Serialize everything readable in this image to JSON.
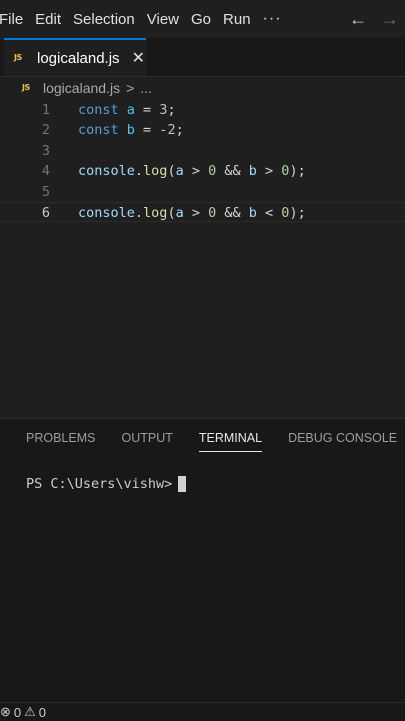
{
  "menubar": {
    "items": [
      "File",
      "Edit",
      "Selection",
      "View",
      "Go",
      "Run"
    ],
    "more": "···",
    "back_icon": "←",
    "forward_icon": "→"
  },
  "tab": {
    "icon_label": "JS",
    "title": "logicaland.js",
    "close": "✕"
  },
  "breadcrumb": {
    "icon_label": "JS",
    "file": "logicaland.js",
    "separator": ">",
    "rest": "..."
  },
  "editor": {
    "current_line": 6,
    "lines": [
      {
        "num": "1",
        "code": "const a = 3;"
      },
      {
        "num": "2",
        "code": "const b = -2;"
      },
      {
        "num": "3",
        "code": ""
      },
      {
        "num": "4",
        "code": "console.log(a > 0 && b > 0);"
      },
      {
        "num": "5",
        "code": ""
      },
      {
        "num": "6",
        "code": "console.log(a > 0 && b < 0);"
      }
    ]
  },
  "panel": {
    "tabs": [
      "PROBLEMS",
      "OUTPUT",
      "TERMINAL",
      "DEBUG CONSOLE"
    ],
    "active_tab": "TERMINAL",
    "terminal_prompt": "PS C:\\Users\\vishw>"
  },
  "statusbar": {
    "errors_icon": "⊗",
    "errors": "0",
    "warnings_icon": "⚠",
    "warnings": "0"
  },
  "colors": {
    "accent": "#0078d4",
    "background": "#1f1f1f",
    "panel": "#181818",
    "keyword": "#569cd6"
  }
}
